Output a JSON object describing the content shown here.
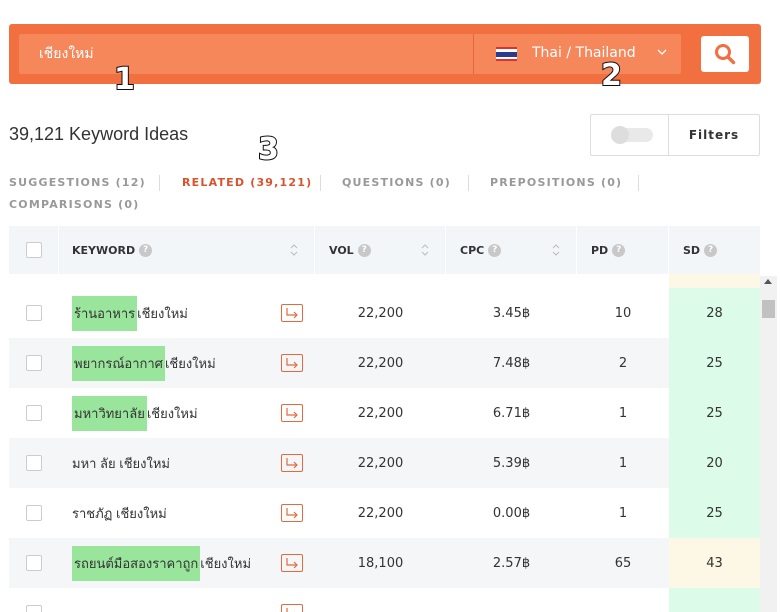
{
  "search": {
    "query": "เชียงใหม่",
    "country": "Thai / Thailand"
  },
  "annotations": [
    "1",
    "2",
    "3"
  ],
  "summary": {
    "title": "39,121 Keyword Ideas",
    "filters_label": "Filters"
  },
  "tabs": [
    {
      "label": "SUGGESTIONS (12)",
      "active": false
    },
    {
      "label": "RELATED (39,121)",
      "active": true
    },
    {
      "label": "QUESTIONS (0)",
      "active": false
    },
    {
      "label": "PREPOSITIONS (0)",
      "active": false
    },
    {
      "label": "COMPARISONS (0)",
      "active": false
    }
  ],
  "table": {
    "headers": {
      "keyword": "KEYWORD",
      "vol": "VOL",
      "cpc": "CPC",
      "pd": "PD",
      "sd": "SD"
    },
    "rows": [
      {
        "highlight": "ร้านอาหาร",
        "rest": " เชียงใหม่",
        "vol": "22,200",
        "cpc": "3.45฿",
        "pd": "10",
        "sd": "28",
        "sd_color": "#ddfbe9"
      },
      {
        "highlight": "พยากรณ์อากาศ",
        "rest": " เชียงใหม่",
        "vol": "22,200",
        "cpc": "7.48฿",
        "pd": "2",
        "sd": "25",
        "sd_color": "#ddfbe9"
      },
      {
        "highlight": "มหาวิทยาลัย",
        "rest": " เชียงใหม่",
        "vol": "22,200",
        "cpc": "6.71฿",
        "pd": "1",
        "sd": "25",
        "sd_color": "#ddfbe9"
      },
      {
        "highlight": "",
        "rest": "มหา ลัย เชียงใหม่",
        "vol": "22,200",
        "cpc": "5.39฿",
        "pd": "1",
        "sd": "20",
        "sd_color": "#ddfbe9"
      },
      {
        "highlight": "",
        "rest": "ราชภัฏ เชียงใหม่",
        "vol": "22,200",
        "cpc": "0.00฿",
        "pd": "1",
        "sd": "25",
        "sd_color": "#ddfbe9"
      },
      {
        "highlight": "รถยนต์มือสองราคาถูก",
        "rest": " เชียงใหม่",
        "vol": "18,100",
        "cpc": "2.57฿",
        "pd": "65",
        "sd": "43",
        "sd_color": "#fdf7e6"
      }
    ]
  },
  "colors": {
    "accent": "#f26f3f",
    "highlight": "#99e59c",
    "sd_easy": "#ddfbe9",
    "sd_medium": "#fdf7e6"
  }
}
